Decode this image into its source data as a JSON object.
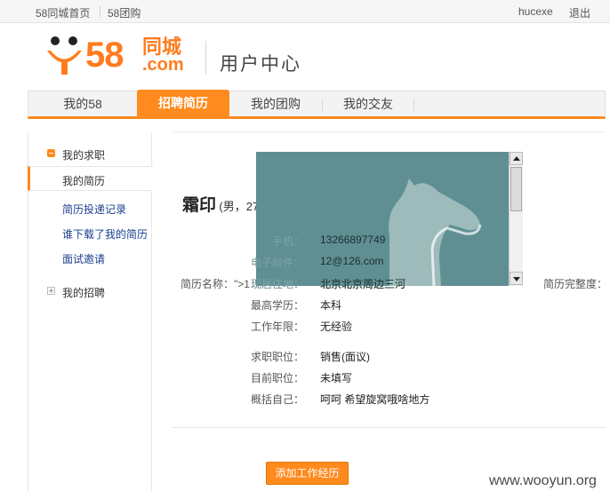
{
  "topbar": {
    "home_link": "58同城首页",
    "group_link": "58团购",
    "username": "hucexe",
    "logout": "退出"
  },
  "logo": {
    "number": "58",
    "brand": "同城",
    "domain": ".com"
  },
  "page_title": "用户中心",
  "nav": {
    "tabs": [
      {
        "label": "我的58"
      },
      {
        "label": "招聘简历",
        "active": true
      },
      {
        "label": "我的团购"
      },
      {
        "label": "我的交友"
      }
    ]
  },
  "sidebar": {
    "job_seek_header": "我的求职",
    "items": [
      {
        "label": "我的简历",
        "active": true
      },
      {
        "label": "简历投递记录"
      },
      {
        "label": "谁下载了我的简历"
      },
      {
        "label": "面试邀请"
      }
    ],
    "recruit_header": "我的招聘"
  },
  "resume": {
    "name": "霜印",
    "meta": "(男，27岁)",
    "resume_name_label": "简历名称：\">1",
    "complete_label": "简历完整度：",
    "rows": [
      {
        "label": "手机：",
        "value": "13266897749"
      },
      {
        "label": "电子邮件：",
        "value": "12@126.com"
      },
      {
        "label": "现居住地：",
        "value": "北京北京周边三河"
      },
      {
        "label": "最高学历：",
        "value": "本科"
      },
      {
        "label": "工作年限：",
        "value": "无经验"
      },
      {
        "label": "求职职位：",
        "value": "销售(面议)"
      },
      {
        "label": "目前职位：",
        "value": "未填写"
      },
      {
        "label": "概括自己：",
        "value": "呵呵 希望旋窝哦啥地方"
      }
    ],
    "add_button": "添加工作经历"
  },
  "watermark": "www.wooyun.org",
  "colors": {
    "accent": "#ff8a1d",
    "link": "#1b3f8f",
    "overlay_bg": "#5f8f93"
  },
  "icons": {
    "logo_mascot": "smiley-mascot-icon",
    "horse": "horse-image"
  }
}
